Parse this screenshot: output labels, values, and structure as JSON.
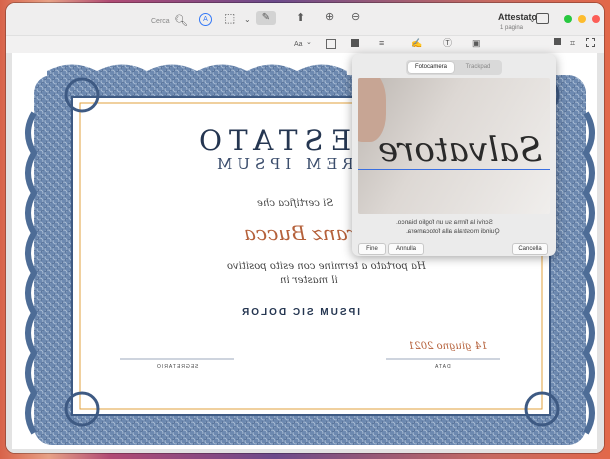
{
  "window": {
    "title": "Attestato",
    "subtitle": "1 pagina"
  },
  "toolbar": {
    "search_placeholder": "Cerca",
    "icons": [
      "search-icon",
      "zoom-out-icon",
      "zoom-in-icon",
      "share-icon",
      "markup-icon",
      "rotate-icon",
      "annotate-icon",
      "sidebar-icon"
    ]
  },
  "markup_bar": {
    "font_label": "Aa",
    "icons": [
      "shapes-icon",
      "text-icon",
      "sign-icon",
      "page-layout-icon",
      "border-color-icon",
      "fill-color-icon",
      "font-icon",
      "select-icon",
      "sketch-icon",
      "draw-icon",
      "crop-icon",
      "note-icon"
    ]
  },
  "signature_popover": {
    "tabs": [
      "Trackpad",
      "Fotocamera"
    ],
    "active_tab": "Fotocamera",
    "signature_text": "Salvatore",
    "instruction_line1": "Scrivi la firma su un foglio bianco.",
    "instruction_line2": "Quindi mostrala alla fotocamera.",
    "buttons": {
      "cancel": "Cancella",
      "undo": "Annulla",
      "done": "Fine"
    }
  },
  "certificate": {
    "title": "ATTESTATO",
    "subtitle": "LOREM IPSUM",
    "certify_line": "Si certifica che",
    "recipient": "Franz Bucca",
    "body_line1": "Ha portato a termine con esito positivo",
    "body_line2": "il master in",
    "course": "IPSUM SIC DOLOR",
    "date": "14 giugno 2021",
    "label_secretary": "SEGRETARIO",
    "label_date": "DATA"
  },
  "colors": {
    "accent": "#2c6ee6",
    "border_blue": "#5b7aa3",
    "certificate_navy": "#253651",
    "signature_red": "#b5613b",
    "orange_frame": "#e2a13c"
  }
}
